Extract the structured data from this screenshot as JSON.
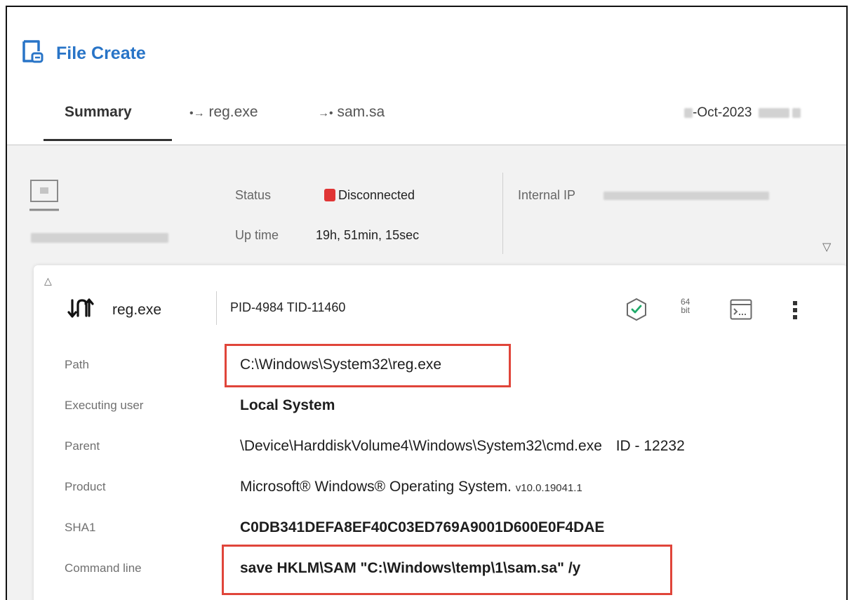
{
  "header": {
    "title": "File Create",
    "icon": "file-create-icon",
    "accent": "#2874c7"
  },
  "tabs": [
    {
      "label": "Summary",
      "prefix": ""
    },
    {
      "label": "reg.exe",
      "prefix": "•→"
    },
    {
      "label": "sam.sa",
      "prefix": "→•"
    }
  ],
  "timestamp": {
    "visible": "-Oct-2023"
  },
  "host": {
    "status_label": "Status",
    "status_value": "Disconnected",
    "status_color": "#e03535",
    "uptime_label": "Up time",
    "uptime_value": "19h, 51min, 15sec",
    "ip_label": "Internal IP"
  },
  "process": {
    "name": "reg.exe",
    "pid_tid": "PID-4984  TID-11460",
    "arch_top": "64",
    "arch_bottom": "bit",
    "rows": [
      {
        "label": "Path",
        "value": "C:\\Windows\\System32\\reg.exe"
      },
      {
        "label": "Executing user",
        "value": "Local System"
      },
      {
        "label": "Parent",
        "value": "\\Device\\HarddiskVolume4\\Windows\\System32\\cmd.exe",
        "extra": "ID - 12232"
      },
      {
        "label": "Product",
        "value": "Microsoft® Windows® Operating System.",
        "extra": "v10.0.19041.1"
      },
      {
        "label": "SHA1",
        "value": "C0DB341DEFA8EF40C03ED769A9001D600E0F4DAE"
      },
      {
        "label": "Command line",
        "value": "save HKLM\\SAM \"C:\\Windows\\temp\\1\\sam.sa\" /y"
      }
    ]
  },
  "highlight_color": "#e0453a"
}
